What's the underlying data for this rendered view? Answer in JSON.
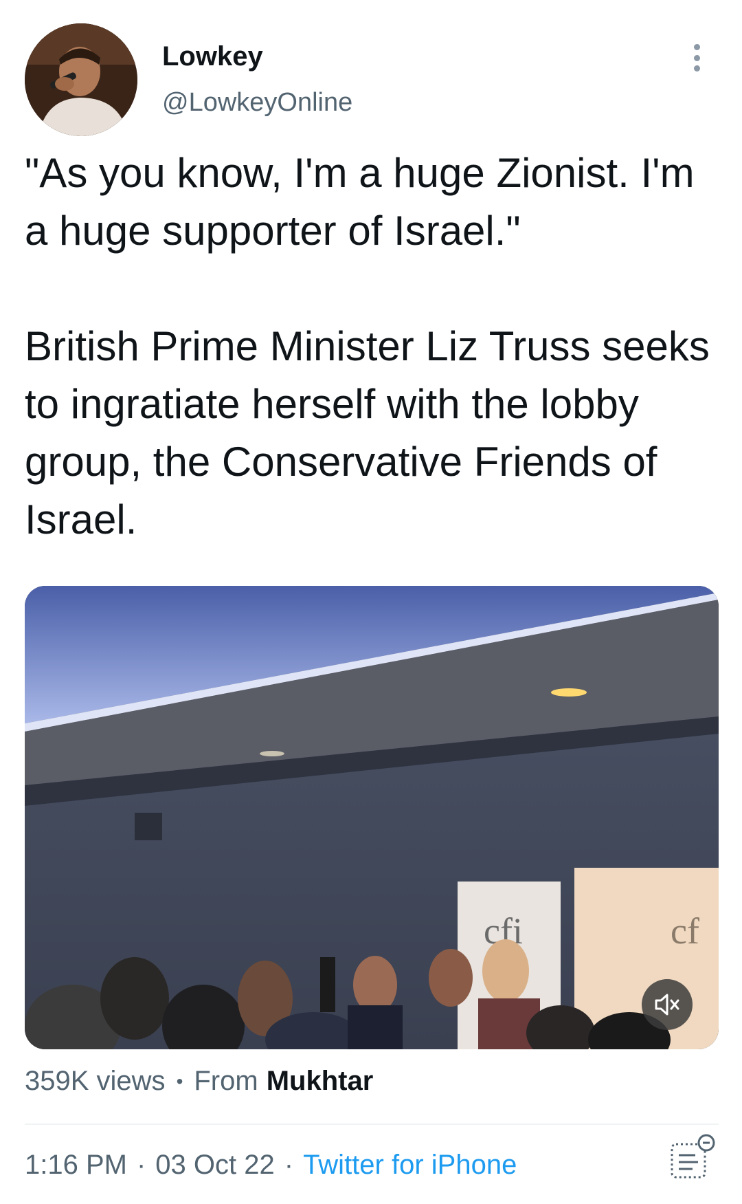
{
  "user": {
    "display_name": "Lowkey",
    "handle": "@LowkeyOnline",
    "avatar_icon": "avatar-photo-icon"
  },
  "tweet": {
    "text": "\"As you know, I'm a huge Zionist. I'm a huge supporter of Israel.\"\n\nBritish Prime Minister Liz Truss seeks to ingratiate herself with the lobby group, the Conservative Friends of Israel.",
    "media": {
      "type": "video",
      "banner_text": "cfi",
      "mute_icon": "volume-muted-icon"
    },
    "views": "359K views",
    "from_label": "From",
    "from_source": "Mukhtar",
    "time": "1:16 PM",
    "date": "03 Oct 22",
    "client": "Twitter for iPhone"
  },
  "icons": {
    "more": "more-vertical-icon",
    "analytics": "view-analytics-icon"
  },
  "colors": {
    "text": "#0f1419",
    "secondary": "#536471",
    "link": "#1d9bf0"
  }
}
